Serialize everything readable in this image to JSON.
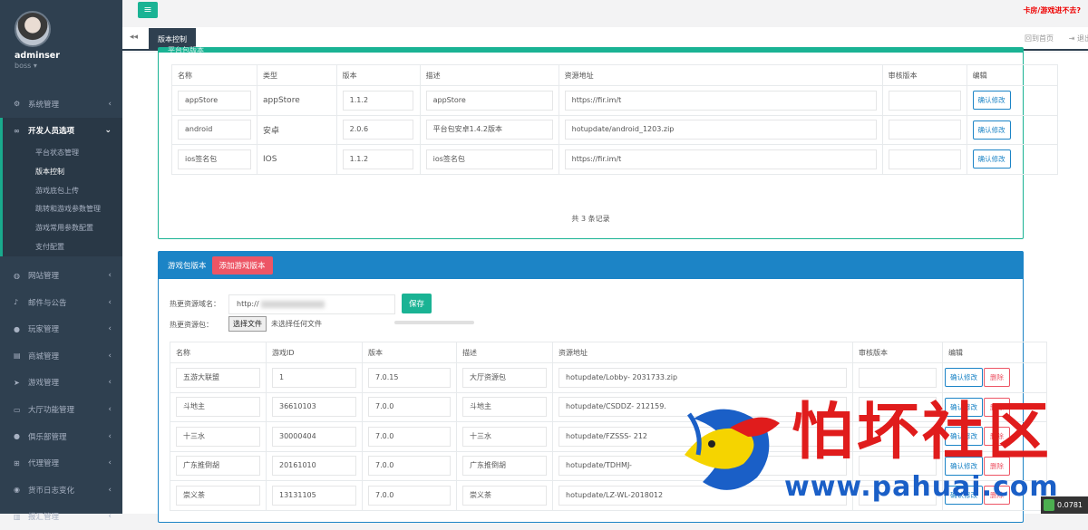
{
  "sidebar": {
    "username": "adminser",
    "role": "boss ▾",
    "items": [
      {
        "label": "系统管理",
        "icon": "gears-icon"
      },
      {
        "label": "开发人员选项",
        "icon": "link-icon"
      },
      {
        "label": "网站管理",
        "icon": "globe-icon"
      },
      {
        "label": "邮件与公告",
        "icon": "bell-icon"
      },
      {
        "label": "玩家管理",
        "icon": "user-icon"
      },
      {
        "label": "商城管理",
        "icon": "cart-icon"
      },
      {
        "label": "游戏管理",
        "icon": "send-icon"
      },
      {
        "label": "大厅功能管理",
        "icon": "desktop-icon"
      },
      {
        "label": "俱乐部管理",
        "icon": "users-icon"
      },
      {
        "label": "代理管理",
        "icon": "sitemap-icon"
      },
      {
        "label": "货币日志变化",
        "icon": "database-icon"
      },
      {
        "label": "报汇管理",
        "icon": "chart-icon"
      }
    ],
    "subitems": [
      "平台状态管理",
      "版本控制",
      "游戏底包上传",
      "跳转和游戏参数管理",
      "游戏常用参数配置",
      "支付配置"
    ]
  },
  "topbar": {
    "menu_icon": "≡",
    "alert_link": "卡房/游戏进不去?"
  },
  "tabs": {
    "active": "版本控制",
    "home": "回到首页",
    "logout": "退出"
  },
  "platform": {
    "title": "平台包版本",
    "headers": [
      "名称",
      "类型",
      "版本",
      "描述",
      "资源地址",
      "审核版本",
      "编辑"
    ],
    "rows": [
      {
        "name": "appStore",
        "type": "appStore",
        "version": "1.1.2",
        "desc": "appStore",
        "url": "https://fir.im/t",
        "review": ""
      },
      {
        "name": "android",
        "type": "安卓",
        "version": "2.0.6",
        "desc": "平台包安卓1.4.2版本",
        "url": "hotupdate/android_1203.zip",
        "review": ""
      },
      {
        "name": "ios签名包",
        "type": "IOS",
        "version": "1.1.2",
        "desc": "ios签名包",
        "url": "https://fir.im/t",
        "review": ""
      }
    ],
    "edit_label": "确认修改",
    "records": "共 3 条记录"
  },
  "game": {
    "title": "游戏包版本",
    "add_label": "添加游戏版本",
    "domain_label": "热更资源域名：",
    "domain_value": "http://",
    "save_label": "保存",
    "file_label": "热更资源包：",
    "file_button": "选择文件",
    "file_status": "未选择任何文件",
    "headers": [
      "名称",
      "游戏ID",
      "版本",
      "描述",
      "资源地址",
      "审核版本",
      "编辑"
    ],
    "rows": [
      {
        "name": "五游大联盟",
        "id": "1",
        "version": "7.0.15",
        "desc": "大厅资源包",
        "url": "hotupdate/Lobby-          2031733.zip"
      },
      {
        "name": "斗地主",
        "id": "36610103",
        "version": "7.0.0",
        "desc": "斗地主",
        "url": "hotupdate/CSDDZ-             212159."
      },
      {
        "name": "十三水",
        "id": "30000404",
        "version": "7.0.0",
        "desc": "十三水",
        "url": "hotupdate/FZSSS-            212"
      },
      {
        "name": "广东推倒胡",
        "id": "20161010",
        "version": "7.0.0",
        "desc": "广东推倒胡",
        "url": "hotupdate/TDHMJ-"
      },
      {
        "name": "崇义茶",
        "id": "13131105",
        "version": "7.0.0",
        "desc": "崇义茶",
        "url": "hotupdate/LZ-WL-2018012"
      }
    ],
    "edit_label": "确认修改",
    "delete_label": "删除"
  },
  "watermark": {
    "cn": "怕坏社区",
    "url": "www.pahuai.com"
  },
  "corner": {
    "text": "0.0781"
  }
}
